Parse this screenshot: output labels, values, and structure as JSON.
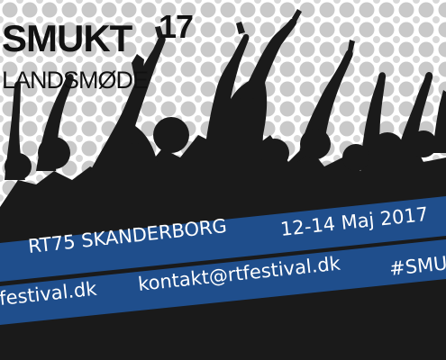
{
  "logo": {
    "name": "SMUKT",
    "number": "17",
    "subtitle": "LANDSMØDE"
  },
  "banner_top": {
    "location": "RT75 SKANDERBORG",
    "dates": "12-14 Maj 2017"
  },
  "banner_bottom": {
    "website": "festival.dk",
    "email": "kontakt@rtfestival.dk",
    "hashtag": "#SMU"
  },
  "colors": {
    "banner": "#1f4e8c",
    "crowd": "#1a1a1a",
    "dots": "#c9c9c9"
  }
}
